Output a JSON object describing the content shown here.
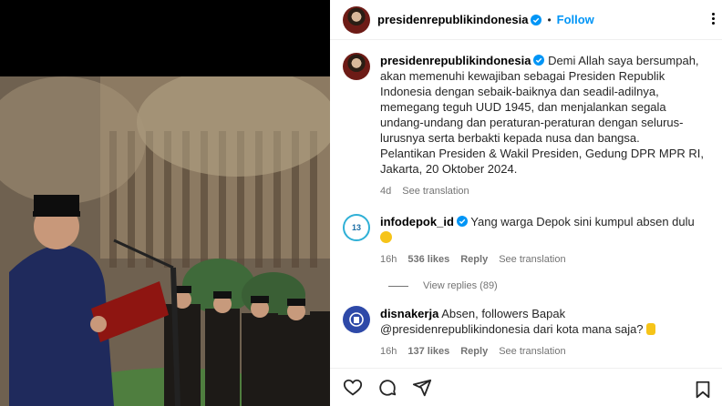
{
  "header": {
    "username": "presidenrepublikindonesia",
    "dot": "•",
    "follow": "Follow"
  },
  "caption": {
    "username": "presidenrepublikindonesia",
    "text1": "Demi Allah saya bersumpah, akan memenuhi kewajiban sebagai Presiden Republik Indonesia dengan sebaik-baiknya dan seadil-adilnya, memegang teguh UUD 1945, dan menjalankan segala undang-undang dan peraturan-peraturan dengan selurus-lurusnya serta berbakti kepada nusa dan bangsa.",
    "text2": "Pelantikan Presiden & Wakil Presiden, Gedung DPR MPR RI, Jakarta, 20 Oktober 2024.",
    "time": "4d",
    "see_translation": "See translation"
  },
  "comments": [
    {
      "username": "infodepok_id",
      "avatar_text": "13",
      "text": "Yang warga Depok sini kumpul absen dulu",
      "time": "16h",
      "likes": "536 likes",
      "reply": "Reply",
      "see_translation": "See translation"
    },
    {
      "username": "disnakerja",
      "text": "Absen, followers Bapak @presidenrepublikindonesia dari kota mana saja?",
      "time": "16h",
      "likes": "137 likes",
      "reply": "Reply",
      "see_translation": "See translation"
    }
  ],
  "view_replies": "View replies (89)",
  "icons": [
    "heart-icon",
    "comment-icon",
    "share-icon",
    "bookmark-icon",
    "verified-icon",
    "more-icon"
  ],
  "colors": {
    "accent": "#0095f6",
    "verified": "#0095f6",
    "muted": "#737373"
  }
}
